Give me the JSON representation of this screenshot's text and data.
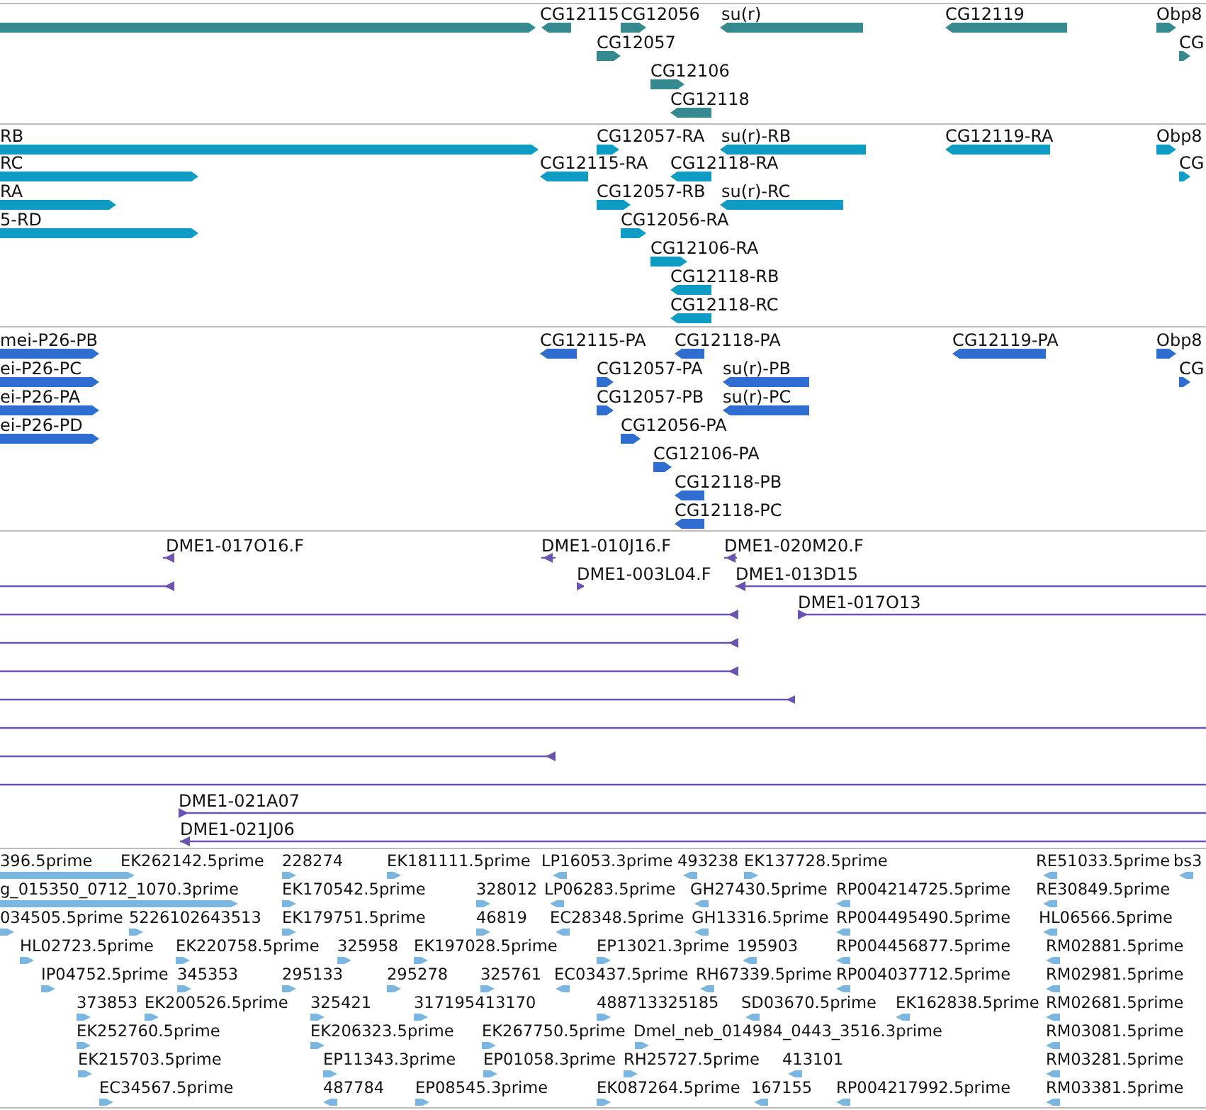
{
  "tracks": [
    {
      "kind": "gene",
      "features": [
        {
          "reverse": false
        },
        {
          "label": "CG12115",
          "reverse": true
        },
        {
          "label": "CG12056",
          "reverse": false
        },
        {
          "label": "su(r)",
          "reverse": true
        },
        {
          "label": "CG12119",
          "reverse": true
        },
        {
          "label": "Obp8",
          "reverse": false
        },
        {
          "label": "CG12057",
          "reverse": false
        },
        {
          "label": "CG",
          "reverse": false
        },
        {
          "label": "CG12106",
          "reverse": false
        },
        {
          "label": "CG12118",
          "reverse": true
        }
      ]
    },
    {
      "kind": "transcript",
      "features": [
        {
          "label": "RB",
          "reverse": false
        },
        {
          "label": "CG12057-RA",
          "reverse": false
        },
        {
          "label": "su(r)-RB",
          "reverse": true
        },
        {
          "label": "CG12119-RA",
          "reverse": true
        },
        {
          "label": "Obp8",
          "reverse": false
        },
        {
          "label": "RC",
          "reverse": false
        },
        {
          "label": "CG12115-RA",
          "reverse": true
        },
        {
          "label": "CG12118-RA",
          "reverse": true
        },
        {
          "label": "CG",
          "reverse": false
        },
        {
          "label": "RA",
          "reverse": false
        },
        {
          "label": "CG12057-RB",
          "reverse": false
        },
        {
          "label": "su(r)-RC",
          "reverse": true
        },
        {
          "label": "5-RD",
          "reverse": false
        },
        {
          "label": "CG12056-RA",
          "reverse": false
        },
        {
          "label": "CG12106-RA",
          "reverse": false
        },
        {
          "label": "CG12118-RB",
          "reverse": true
        },
        {
          "label": "CG12118-RC",
          "reverse": true
        }
      ]
    },
    {
      "kind": "protein",
      "features": [
        {
          "label": "mei-P26-PB",
          "reverse": false
        },
        {
          "label": "CG12115-PA",
          "reverse": true
        },
        {
          "label": "CG12118-PA",
          "reverse": true
        },
        {
          "label": "CG12119-PA",
          "reverse": true
        },
        {
          "label": "Obp8",
          "reverse": false
        },
        {
          "label": "ei-P26-PC",
          "reverse": false
        },
        {
          "label": "CG12057-PA",
          "reverse": false
        },
        {
          "label": "su(r)-PB",
          "reverse": true
        },
        {
          "label": "CG",
          "reverse": false
        },
        {
          "label": "ei-P26-PA",
          "reverse": false
        },
        {
          "label": "CG12057-PB",
          "reverse": false
        },
        {
          "label": "su(r)-PC",
          "reverse": true
        },
        {
          "label": "ei-P26-PD",
          "reverse": false
        },
        {
          "label": "CG12056-PA",
          "reverse": false
        },
        {
          "label": "CG12106-PA",
          "reverse": false
        },
        {
          "label": "CG12118-PB",
          "reverse": true
        },
        {
          "label": "CG12118-PC",
          "reverse": true
        }
      ]
    },
    {
      "kind": "clone",
      "features": [
        {
          "kind": "arrow",
          "label": "DME1-017O16.F",
          "reverse": true
        },
        {
          "kind": "arrow",
          "label": "DME1-010J16.F",
          "reverse": true
        },
        {
          "kind": "arrow",
          "label": "DME1-020M20.F",
          "reverse": true
        },
        {
          "kind": "arrow",
          "reverse": true
        },
        {
          "kind": "arrow",
          "label": "DME1-003L04.F",
          "reverse": false
        },
        {
          "kind": "arrow",
          "label": "DME1-013D15",
          "reverse": true
        },
        {
          "kind": "arrow",
          "reverse": true
        },
        {
          "kind": "arrow",
          "label": "DME1-017O13",
          "reverse": false
        },
        {
          "kind": "arrow",
          "reverse": true
        },
        {
          "kind": "arrow",
          "reverse": true
        },
        {
          "kind": "arrow",
          "reverse": true
        },
        {
          "kind": "plain"
        },
        {
          "kind": "arrow",
          "reverse": true
        },
        {
          "kind": "plain"
        },
        {
          "kind": "arrow",
          "label": "DME1-021A07",
          "reverse": false
        },
        {
          "kind": "arrow",
          "label": "DME1-021J06",
          "reverse": true
        }
      ]
    },
    {
      "kind": "est",
      "features": [
        {
          "label": "396.5prime",
          "reverse": false
        },
        {
          "label": "EK262142.5prime",
          "reverse": false
        },
        {
          "label": "228274",
          "reverse": false
        },
        {
          "label": "EK181111.5prime",
          "reverse": false
        },
        {
          "label": "LP16053.3prime",
          "reverse": true
        },
        {
          "label": "493238",
          "reverse": true
        },
        {
          "label": "EK137728.5prime",
          "reverse": false
        },
        {
          "label": "RE51033.5prime",
          "reverse": true
        },
        {
          "label": "bs3",
          "reverse": true
        },
        {
          "label": "g_015350_0712_1070.3prime",
          "reverse": false
        },
        {
          "label": "EK170542.5prime",
          "reverse": false
        },
        {
          "label": "328012",
          "reverse": false
        },
        {
          "label": "LP06283.5prime",
          "reverse": true
        },
        {
          "label": "GH27430.5prime",
          "reverse": true
        },
        {
          "label": "RP004214725.5prime",
          "reverse": true
        },
        {
          "label": "RE30849.5prime",
          "reverse": true
        },
        {
          "label": "034505.5prime",
          "reverse": false
        },
        {
          "label": "5226102643513",
          "reverse": false
        },
        {
          "label": "EK179751.5prime",
          "reverse": false
        },
        {
          "label": "46819",
          "reverse": false
        },
        {
          "label": "EC28348.5prime",
          "reverse": true
        },
        {
          "label": "GH13316.5prime",
          "reverse": true
        },
        {
          "label": "RP004495490.5prime",
          "reverse": true
        },
        {
          "label": "HL06566.5prime",
          "reverse": true
        },
        {
          "label": "HL02723.5prime",
          "reverse": false
        },
        {
          "label": "EK220758.5prime",
          "reverse": false
        },
        {
          "label": "325958",
          "reverse": false
        },
        {
          "label": "EK197028.5prime",
          "reverse": false
        },
        {
          "label": "EP13021.3prime",
          "reverse": false
        },
        {
          "label": "195903",
          "reverse": true
        },
        {
          "label": "RP004456877.5prime",
          "reverse": true
        },
        {
          "label": "RM02881.5prime",
          "reverse": true
        },
        {
          "label": "IP04752.5prime",
          "reverse": false
        },
        {
          "label": "345353",
          "reverse": false
        },
        {
          "label": "295133",
          "reverse": false
        },
        {
          "label": "295278",
          "reverse": false
        },
        {
          "label": "325761",
          "reverse": false
        },
        {
          "label": "EC03437.5prime",
          "reverse": true
        },
        {
          "label": "RH67339.5prime",
          "reverse": true
        },
        {
          "label": "RP004037712.5prime",
          "reverse": true
        },
        {
          "label": "RM02981.5prime",
          "reverse": true
        },
        {
          "label": "373853",
          "reverse": false
        },
        {
          "label": "EK200526.5prime",
          "reverse": false
        },
        {
          "label": "325421",
          "reverse": false
        },
        {
          "label": "317195413170",
          "reverse": false
        },
        {
          "label": "488713325185",
          "reverse": false
        },
        {
          "label": "SD03670.5prime",
          "reverse": true
        },
        {
          "label": "EK162838.5prime",
          "reverse": true
        },
        {
          "label": "RM02681.5prime",
          "reverse": true
        },
        {
          "label": "EK252760.5prime",
          "reverse": false
        },
        {
          "label": "EK206323.5prime",
          "reverse": false
        },
        {
          "label": "EK267750.5prime",
          "reverse": false
        },
        {
          "label": "Dmel_neb_014984_0443_3516.3prime",
          "reverse": false
        },
        {
          "label": "RM03081.5prime",
          "reverse": true
        },
        {
          "label": "EK215703.5prime",
          "reverse": false
        },
        {
          "label": "EP11343.3prime",
          "reverse": false
        },
        {
          "label": "EP01058.3prime",
          "reverse": false
        },
        {
          "label": "RH25727.5prime",
          "reverse": false
        },
        {
          "label": "413101",
          "reverse": true
        },
        {
          "label": "RM03281.5prime",
          "reverse": true
        },
        {
          "label": "EC34567.5prime",
          "reverse": false
        },
        {
          "label": "487784",
          "reverse": true
        },
        {
          "label": "EP08545.3prime",
          "reverse": false
        },
        {
          "label": "EK087264.5prime",
          "reverse": false
        },
        {
          "label": "167155",
          "reverse": true
        },
        {
          "label": "RP004217992.5prime",
          "reverse": true
        },
        {
          "label": "RM03381.5prime",
          "reverse": true
        }
      ]
    }
  ]
}
